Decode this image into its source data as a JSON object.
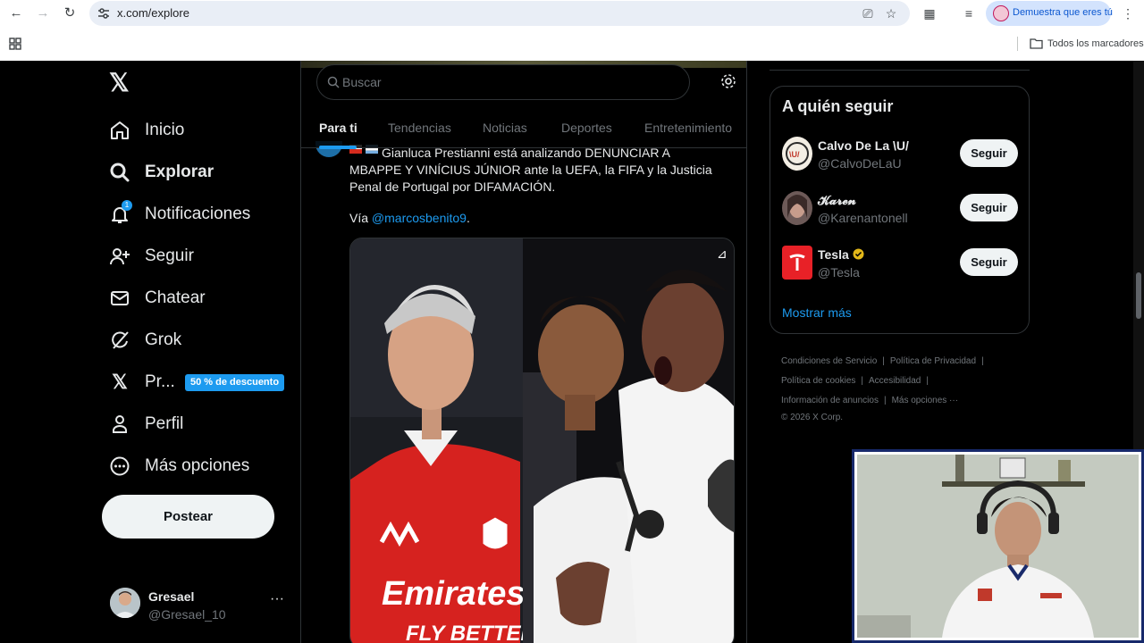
{
  "browser": {
    "url": "x.com/explore",
    "profile_label": "Demuestra que eres tú",
    "bookmarks_label": "Todos los marcadores"
  },
  "sidebar": {
    "items": [
      {
        "label": "Inicio",
        "icon": "home-icon"
      },
      {
        "label": "Explorar",
        "icon": "search-icon",
        "active": true
      },
      {
        "label": "Notificaciones",
        "icon": "bell-icon",
        "badge": "1"
      },
      {
        "label": "Seguir",
        "icon": "add-person-icon"
      },
      {
        "label": "Chatear",
        "icon": "mail-icon"
      },
      {
        "label": "Grok",
        "icon": "grok-icon"
      },
      {
        "label": "Pr...",
        "icon": "x-premium-icon",
        "promo": "50 % de descuento"
      },
      {
        "label": "Perfil",
        "icon": "person-icon"
      },
      {
        "label": "Más opciones",
        "icon": "more-circle-icon"
      }
    ],
    "post_button": "Postear",
    "account": {
      "name": "Gresael",
      "handle": "@Gresael_10"
    }
  },
  "search": {
    "placeholder": "Buscar"
  },
  "tabs": [
    "Para ti",
    "Tendencias",
    "Noticias",
    "Deportes",
    "Entretenimiento"
  ],
  "tweet": {
    "text": "Gianluca Prestianni está analizando DENUNCIAR A MBAPPE Y VINÍCIUS JÚNIOR ante la UEFA, la FIFA y la Justicia Penal de Portugal por DIFAMACIÓN.",
    "via_prefix": "Vía ",
    "via_mention": "@marcosbenito9",
    "via_suffix": ".",
    "media_jersey_text_1": "Emirates",
    "media_jersey_text_2": "FLY BETTER"
  },
  "who_to_follow": {
    "title": "A quién seguir",
    "users": [
      {
        "name": "Calvo De La \\U/",
        "handle": "@CalvoDeLaU",
        "button": "Seguir"
      },
      {
        "name": "𝓚𝓪𝓻𝓮𝓷",
        "handle": "@Karenantonell",
        "button": "Seguir"
      },
      {
        "name": "Tesla",
        "handle": "@Tesla",
        "button": "Seguir",
        "verified": true
      }
    ],
    "show_more": "Mostrar más"
  },
  "footer": {
    "links": [
      "Condiciones de Servicio",
      "Política de Privacidad",
      "Política de cookies",
      "Accesibilidad",
      "Información de anuncios",
      "Más opciones ···"
    ],
    "copyright": "© 2026 X Corp."
  },
  "colors": {
    "accent": "#1d9bf0",
    "background": "#000000",
    "border": "#2f3336",
    "muted": "#71767b"
  }
}
